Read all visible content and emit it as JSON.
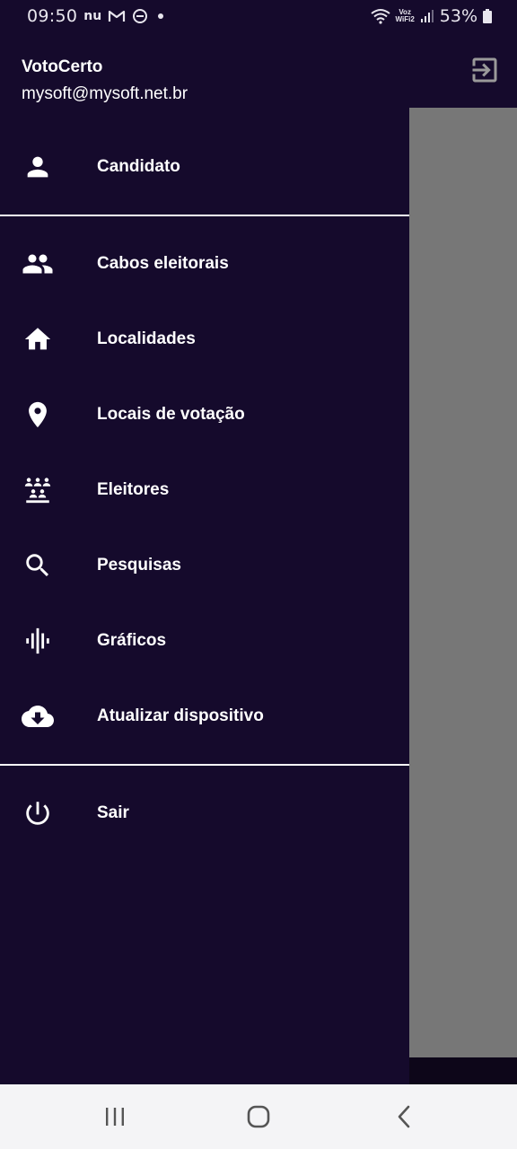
{
  "status_bar": {
    "time": "09:50",
    "notif_nu": "nu",
    "voz_top": "Voz",
    "voz_bottom": "WiFi2",
    "battery": "53%"
  },
  "drawer": {
    "app_name": "VotoCerto",
    "user_email": "mysoft@mysoft.net.br",
    "items": [
      {
        "label": "Candidato",
        "icon": "person-icon"
      },
      {
        "label": "Cabos eleitorais",
        "icon": "people-icon"
      },
      {
        "label": "Localidades",
        "icon": "home-icon"
      },
      {
        "label": "Locais de votação",
        "icon": "location-pin-icon"
      },
      {
        "label": "Eleitores",
        "icon": "voters-icon"
      },
      {
        "label": "Pesquisas",
        "icon": "search-icon"
      },
      {
        "label": "Gráficos",
        "icon": "graphic-eq-icon"
      },
      {
        "label": "Atualizar dispositivo",
        "icon": "cloud-download-icon"
      },
      {
        "label": "Sair",
        "icon": "power-icon"
      }
    ]
  },
  "colors": {
    "drawer_bg": "#150a2c",
    "scrim": "#777777",
    "text": "#ffffff",
    "nav_bar": "#f4f4f6"
  }
}
